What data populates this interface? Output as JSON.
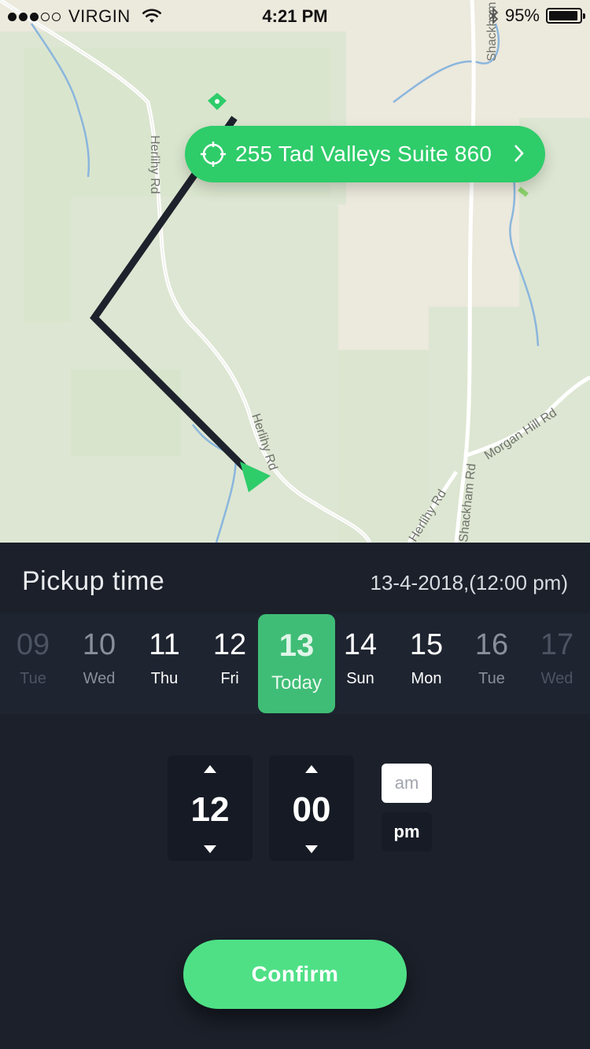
{
  "status_bar": {
    "carrier": "VIRGIN",
    "time": "4:21 PM",
    "battery": "95%",
    "battery_level": 0.95,
    "signal_bars_filled": 3,
    "signal_bars_total": 5
  },
  "map": {
    "road_labels": [
      "Herlihy Rd",
      "Herlihy Rd",
      "Herlihy Rd",
      "Shackham Rd",
      "Shackham Rd",
      "Morgan Hill Rd"
    ],
    "address": "255 Tad Valleys Suite 860",
    "colors": {
      "route": "#1d222c",
      "accent": "#2fcc6a",
      "land": "#dde6d2",
      "water": "#8ab6dd"
    }
  },
  "pickup": {
    "title": "Pickup time",
    "selected_datetime": "13-4-2018,(12:00 pm)"
  },
  "days": [
    {
      "num": "09",
      "label": "Tue"
    },
    {
      "num": "10",
      "label": "Wed"
    },
    {
      "num": "11",
      "label": "Thu"
    },
    {
      "num": "12",
      "label": "Fri"
    },
    {
      "num": "13",
      "label": "Today"
    },
    {
      "num": "14",
      "label": "Sun"
    },
    {
      "num": "15",
      "label": "Mon"
    },
    {
      "num": "16",
      "label": "Tue"
    },
    {
      "num": "17",
      "label": "Wed"
    }
  ],
  "time": {
    "hour": "12",
    "minute": "00",
    "am_label": "am",
    "pm_label": "pm",
    "selected_period": "pm"
  },
  "confirm_label": "Confirm"
}
